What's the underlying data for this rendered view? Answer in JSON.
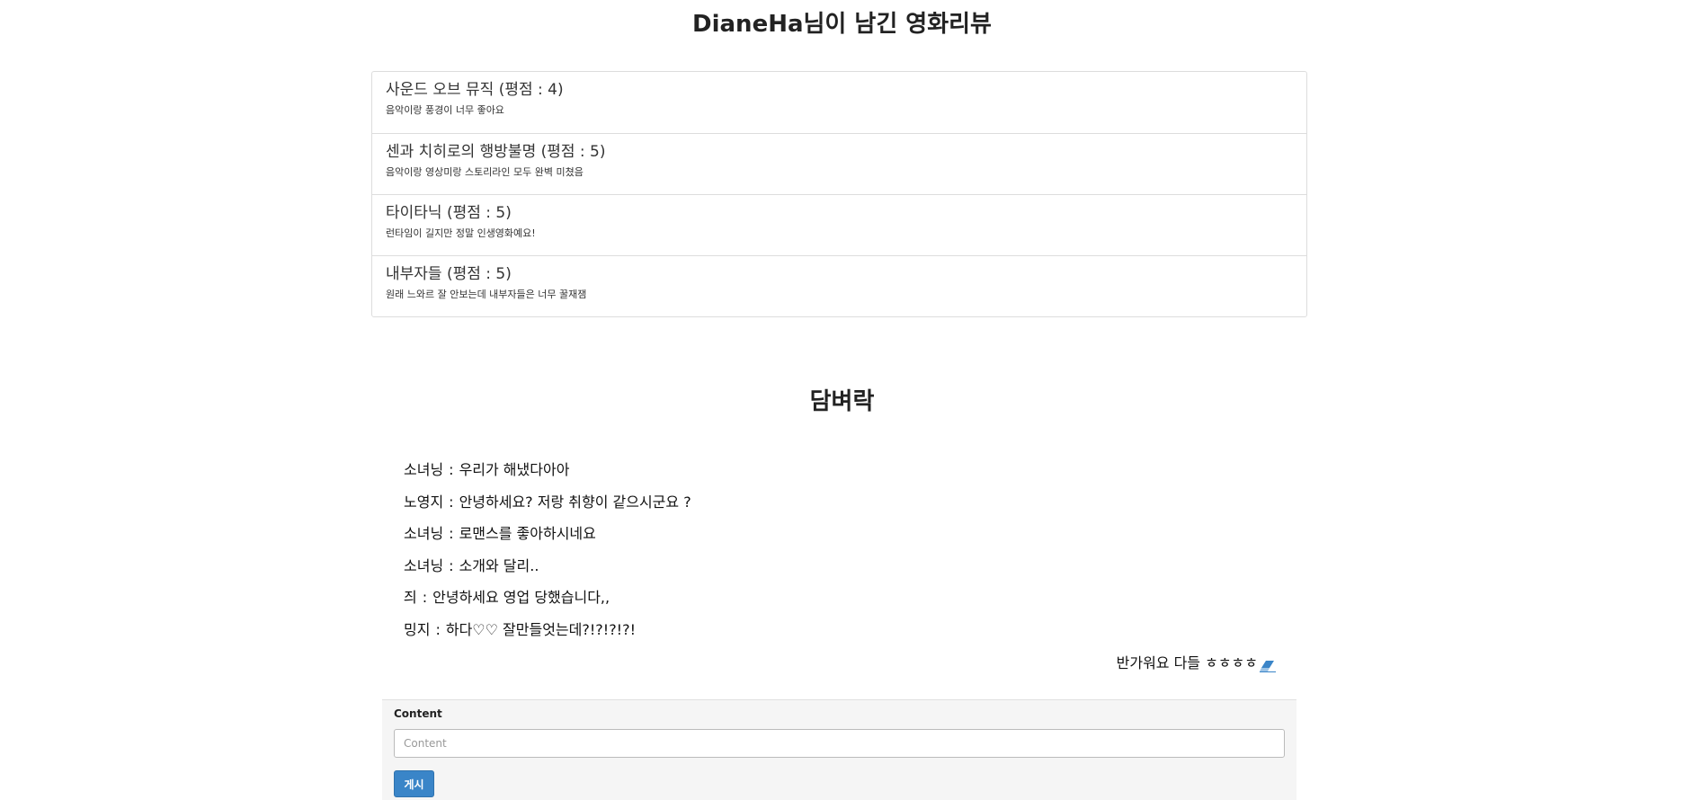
{
  "reviews_section": {
    "title": "DianeHa님이 남긴 영화리뷰",
    "items": [
      {
        "title": "사운드 오브 뮤직 (평점 : 4)",
        "comment": "음악이랑 풍경이 너무 좋아요"
      },
      {
        "title": "센과 치히로의 행방불명 (평점 : 5)",
        "comment": "음악이랑 영상미랑 스토리라인 모두 완벽 미쳤음"
      },
      {
        "title": "타이타닉 (평점 : 5)",
        "comment": "런타임이 길지만 정말 인생영화예요!"
      },
      {
        "title": "내부자들 (평점 : 5)",
        "comment": "원래 느와르 잘 안보는데 내부자들은 너무 꿀재잼"
      }
    ]
  },
  "chat_section": {
    "title": "담벼락",
    "separator": ":",
    "messages": [
      {
        "author": "소녀닝",
        "text": "우리가 해냈다아아"
      },
      {
        "author": "노영지",
        "text": "안녕하세요? 저랑 취향이 같으시군요 ?"
      },
      {
        "author": "소녀닝",
        "text": "로맨스를 좋아하시네요"
      },
      {
        "author": "소녀닝",
        "text": "소개와 달리.."
      },
      {
        "author": "즤",
        "text": "안녕하세요 영업 당했습니다,,"
      },
      {
        "author": "밍지",
        "text": "하다♡♡ 잘만들엇는데?!?!?!?!"
      }
    ],
    "my_message": {
      "text": "반가워요 다들 ㅎㅎㅎㅎ",
      "icon": "eraser-icon",
      "icon_color": "#3a85c8"
    },
    "form": {
      "label": "Content",
      "placeholder": "Content",
      "value": "",
      "submit_label": "게시",
      "submit_color": "#3a85c8"
    }
  }
}
